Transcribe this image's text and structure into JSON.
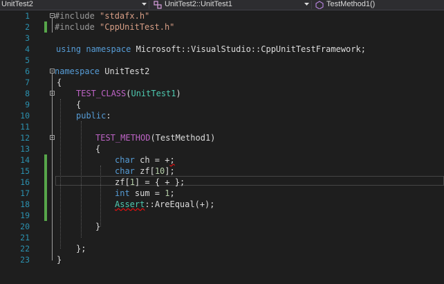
{
  "navbar": {
    "project": "UnitTest2",
    "class_scope": "UnitTest2::UnitTest1",
    "member": "TestMethod1()",
    "icons": [
      "dropdown-arrow-icon",
      "class-icon",
      "method-icon"
    ]
  },
  "colors": {
    "background": "#1e1e1e",
    "line_number": "#2b91af",
    "keyword": "#569cd6",
    "string": "#d69d85",
    "macro": "#bd63c5",
    "type": "#4ec9b0",
    "change_bar": "#57a64a",
    "error_squiggle": "#e01010"
  },
  "line_numbers": [
    "1",
    "2",
    "3",
    "4",
    "5",
    "6",
    "7",
    "8",
    "9",
    "10",
    "11",
    "12",
    "13",
    "14",
    "15",
    "16",
    "17",
    "18",
    "19",
    "20",
    "21",
    "22",
    "23"
  ],
  "code": {
    "l1": {
      "directive": "#include",
      "file": "\"stdafx.h\""
    },
    "l2": {
      "directive": "#include",
      "file": "\"CppUnitTest.h\""
    },
    "l4": {
      "kw1": "using",
      "kw2": "namespace",
      "rest": "Microsoft::VisualStudio::CppUnitTestFramework;"
    },
    "l6": {
      "kw": "namespace",
      "name": "UnitTest2"
    },
    "l7": {
      "text": "{"
    },
    "l8": {
      "macro": "TEST_CLASS",
      "open": "(",
      "arg": "UnitTest1",
      "close": ")"
    },
    "l9": {
      "text": "{"
    },
    "l10": {
      "kw": "public",
      "colon": ":"
    },
    "l12": {
      "macro": "TEST_METHOD",
      "args": "(TestMethod1)"
    },
    "l13": {
      "text": "{"
    },
    "l14": {
      "kw": "char",
      "rest": " ch = +",
      "err": ";"
    },
    "l15": {
      "kw": "char",
      "rest1": " zf[",
      "num": "10",
      "rest2": "];"
    },
    "l16": {
      "rest1": "zf[",
      "num": "1",
      "rest2": "] = { + };"
    },
    "l17": {
      "kw": "int",
      "rest1": " sum = ",
      "num": "1",
      "rest2": ";"
    },
    "l18": {
      "type": "Assert",
      "sep": "::",
      "fn": "AreEqual",
      "args": "(+);"
    },
    "l20": {
      "text": "}"
    },
    "l22": {
      "text": "};"
    },
    "l23": {
      "text": "}"
    }
  }
}
